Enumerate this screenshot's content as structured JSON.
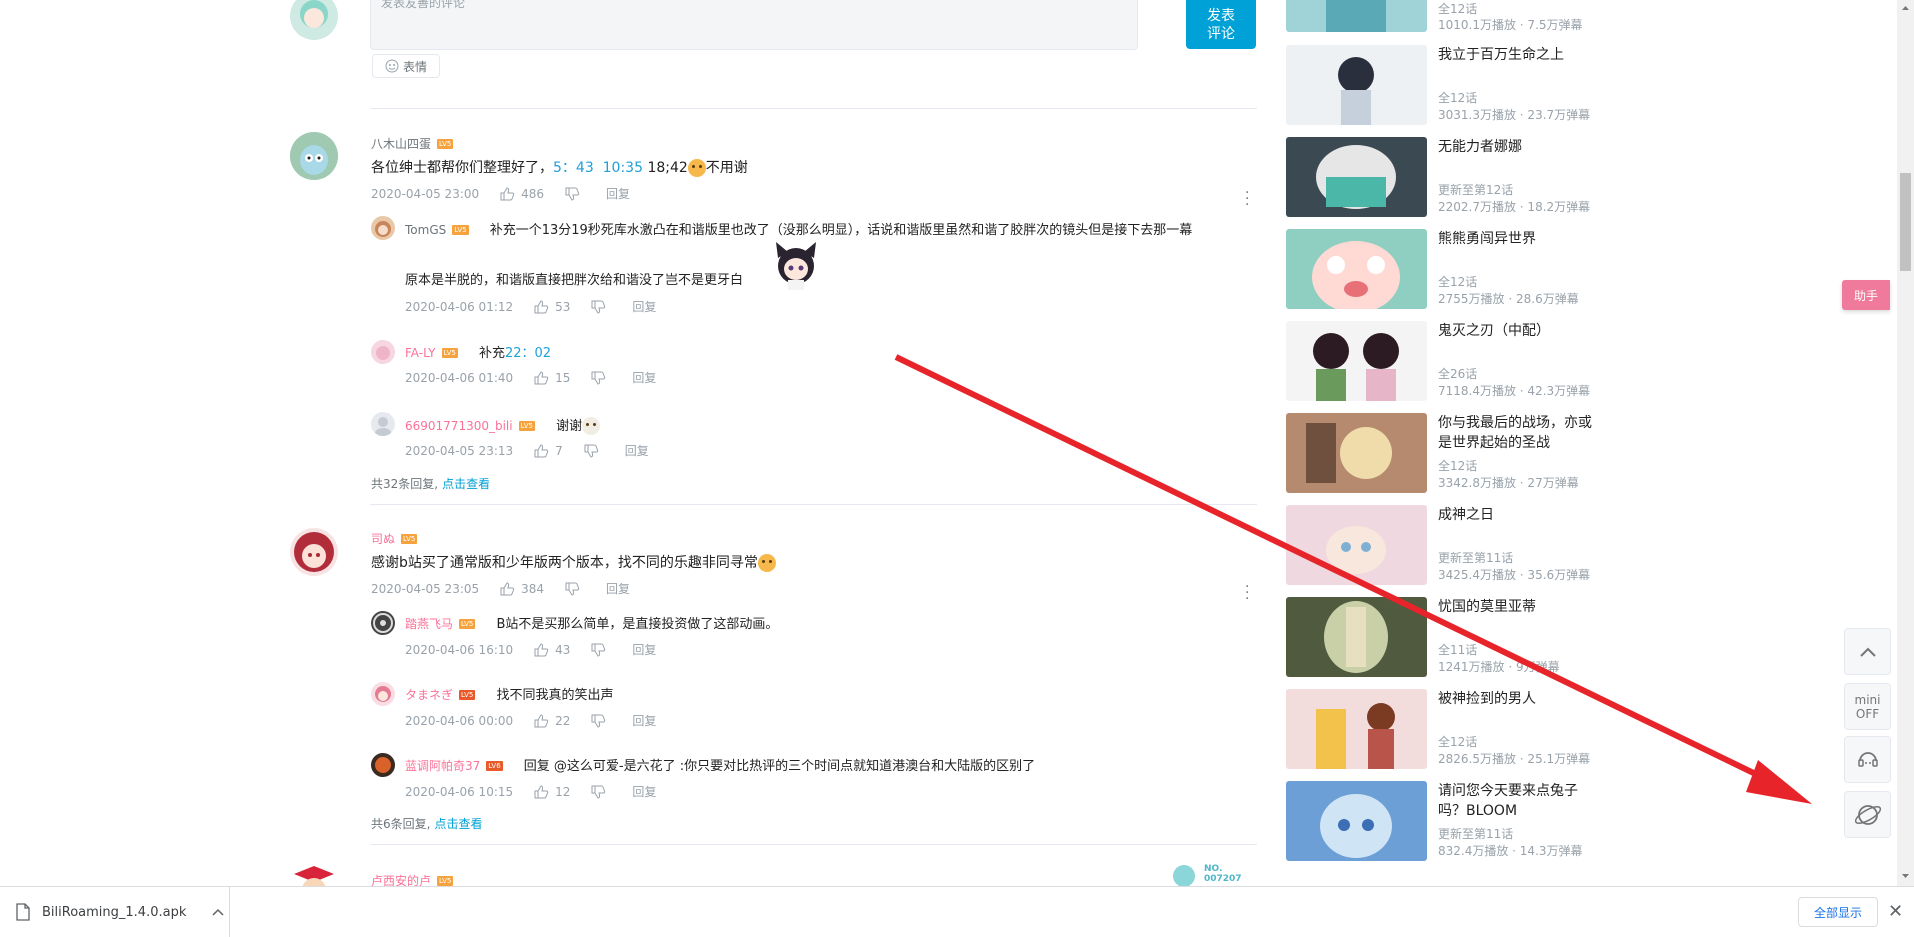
{
  "composer": {
    "placeholder": "发表友善的评论",
    "send_label_1": "发表",
    "send_label_2": "评论",
    "emoji_label": "表情"
  },
  "comments": [
    {
      "user": "八木山四蛋",
      "level": "LV5",
      "text_pre": "各位绅士都帮你们整理好了，",
      "ts1": "5：43",
      "ts2": "10:35",
      "text_post": " 18;42",
      "text_end": "不用谢",
      "date": "2020-04-05 23:00",
      "likes": "486",
      "reply_label": "回复",
      "replies": [
        {
          "user": "TomGS",
          "level": "LV5",
          "text": "补充一个13分19秒死库水激凸在和谐版里也改了（没那么明显），话说和谐版里虽然和谐了胶胖次的镜头但是接下去那一幕",
          "text2": "原本是半脱的，和谐版直接把胖次给和谐没了岂不是更牙白",
          "date": "2020-04-06 01:12",
          "likes": "53",
          "reply_label": "回复"
        },
        {
          "user": "FA-LY",
          "level": "LV5",
          "text_pre": "补充",
          "ts": "22：02",
          "date": "2020-04-06 01:40",
          "likes": "15",
          "reply_label": "回复"
        },
        {
          "user": "66901771300_bili",
          "level": "LV5",
          "text": "谢谢",
          "date": "2020-04-05 23:13",
          "likes": "7",
          "reply_label": "回复"
        }
      ],
      "more_text": "共32条回复,",
      "more_link": "点击查看"
    },
    {
      "user": "司ぬ",
      "level": "LV5",
      "text": "感谢b站买了通常版和少年版两个版本，找不同的乐趣非同寻常",
      "date": "2020-04-05 23:05",
      "likes": "384",
      "reply_label": "回复",
      "replies": [
        {
          "user": "踏燕飞马",
          "level": "LV5",
          "text": "B站不是买那么简单，是直接投资做了这部动画。",
          "date": "2020-04-06 16:10",
          "likes": "43",
          "reply_label": "回复"
        },
        {
          "user": "タまネぎ",
          "level": "LV5",
          "text": "找不同我真的笑出声",
          "date": "2020-04-06 00:00",
          "likes": "22",
          "reply_label": "回复"
        },
        {
          "user": "蓝调阿帕奇37",
          "level": "LV6",
          "text": "回复 @这么可爱-是六花了 :你只要对比热评的三个时间点就知道港澳台和大陆版的区别了",
          "date": "2020-04-06 10:15",
          "likes": "12",
          "reply_label": "回复"
        }
      ],
      "more_text": "共6条回复,",
      "more_link": "点击查看"
    },
    {
      "user": "卢西安的卢",
      "level": "LV5",
      "badge": "NO. 007207"
    }
  ],
  "sidebar": [
    {
      "title": "",
      "status": "全12话",
      "stats": "1010.1万播放 · 7.5万弹幕"
    },
    {
      "title": "我立于百万生命之上",
      "status": "全12话",
      "stats": "3031.3万播放 · 23.7万弹幕"
    },
    {
      "title": "无能力者娜娜",
      "status": "更新至第12话",
      "stats": "2202.7万播放 · 18.2万弹幕"
    },
    {
      "title": "熊熊勇闯异世界",
      "status": "全12话",
      "stats": "2755万播放 · 28.6万弹幕"
    },
    {
      "title": "鬼灭之刃（中配）",
      "status": "全26话",
      "stats": "7118.4万播放 · 42.3万弹幕"
    },
    {
      "title": "你与我最后的战场，亦或是世界起始的圣战",
      "status": "全12话",
      "stats": "3342.8万播放 · 27万弹幕"
    },
    {
      "title": "成神之日",
      "status": "更新至第11话",
      "stats": "3425.4万播放 · 35.6万弹幕"
    },
    {
      "title": "忧国的莫里亚蒂",
      "status": "全11话",
      "stats": "1241万播放 · 9万弹幕"
    },
    {
      "title": "被神捡到的男人",
      "status": "全12话",
      "stats": "2826.5万播放 · 25.1万弹幕"
    },
    {
      "title": "请问您今天要来点兔子吗？BLOOM",
      "status": "更新至第11话",
      "stats": "832.4万播放 · 14.3万弹幕"
    }
  ],
  "tools": {
    "helper": "助手",
    "mini_1": "mini",
    "mini_2": "OFF"
  },
  "download": {
    "filename": "BiliRoaming_1.4.0.apk",
    "show_all": "全部显示"
  },
  "colors": {
    "accent": "#00a1d6",
    "pink": "#fb7299",
    "arrow": "#e8242b"
  }
}
